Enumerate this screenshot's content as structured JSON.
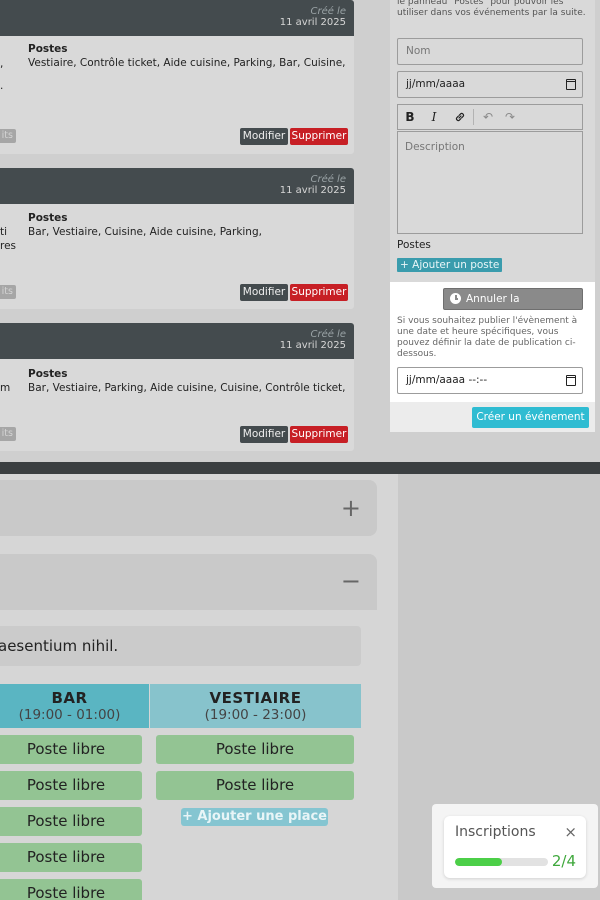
{
  "events": [
    {
      "created_label": "Créé le",
      "created_date": "11 avril 2025",
      "postes_label": "Postes",
      "postes_list": "Vestiaire, Contrôle ticket, Aide cuisine, Parking, Bar, Cuisine,",
      "left_fragments": [
        ",",
        "."
      ],
      "tag": "its",
      "edit_label": "Modifier",
      "delete_label": "Supprimer"
    },
    {
      "created_label": "Créé le",
      "created_date": "11 avril 2025",
      "postes_label": "Postes",
      "postes_list": "Bar, Vestiaire, Cuisine, Aide cuisine, Parking,",
      "left_fragments": [
        "ti",
        "res"
      ],
      "tag": "its",
      "edit_label": "Modifier",
      "delete_label": "Supprimer"
    },
    {
      "created_label": "Créé le",
      "created_date": "11 avril 2025",
      "postes_label": "Postes",
      "postes_list": "Bar, Vestiaire, Parking, Aide cuisine, Cuisine, Contrôle ticket,",
      "left_fragments": [
        "m"
      ],
      "tag": "its",
      "edit_label": "Modifier",
      "delete_label": "Supprimer"
    }
  ],
  "form": {
    "hint_top": "le panneau \"Postes\" pour pouvoir les utiliser dans vos événements par la suite.",
    "name_placeholder": "Nom",
    "date_placeholder": "jj/mm/aaaa",
    "toolbar": {
      "bold": "B",
      "italic": "I",
      "link": "🔗",
      "undo": "↶",
      "redo": "↷"
    },
    "description_placeholder": "Description",
    "postes_title": "Postes",
    "add_poste_label": "+ Ajouter un poste",
    "cancel_schedule_label": "Annuler la planification",
    "schedule_text": "Si vous souhaitez publier l'évènement à une date et heure spécifiques, vous pouvez définir la date de publication ci-dessous.",
    "schedule_datetime_placeholder": "jj/mm/aaaa --:--",
    "create_label": "Créer un événement"
  },
  "bottom": {
    "accordion_collapsed_icon": "+",
    "accordion_expanded_icon": "−",
    "description_fragment": "aesentium nihil.",
    "columns": [
      {
        "name": "BAR",
        "time": "(19:00 - 01:00)",
        "slots": [
          "Poste libre",
          "Poste libre",
          "Poste libre",
          "Poste libre",
          "Poste libre"
        ]
      },
      {
        "name": "VESTIAIRE",
        "time": "(19:00 - 23:00)",
        "slots": [
          "Poste libre",
          "Poste libre"
        ]
      }
    ],
    "add_place_label": "+ Ajouter une place"
  },
  "inscriptions": {
    "title": "Inscriptions",
    "close_icon": "×",
    "count": "2/4",
    "progress_fraction": 0.5
  },
  "colors": {
    "dark_header": "#444b4e",
    "danger": "#c71f25",
    "accent": "#2fbcd2",
    "slot_green": "#93c493",
    "progress_green": "#4ccf48"
  }
}
